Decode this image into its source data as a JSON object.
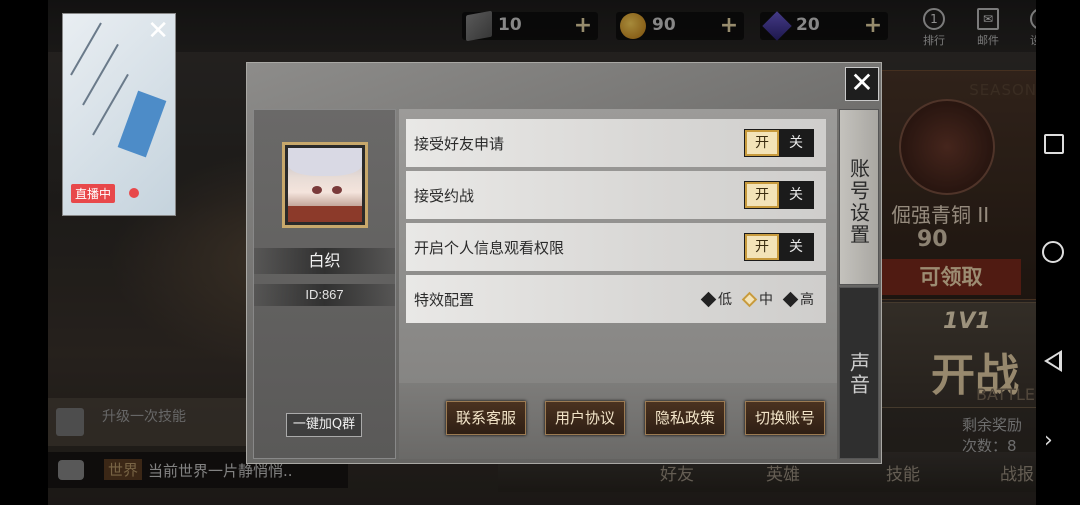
{
  "background": {
    "resources": [
      {
        "icon": "book-icon",
        "value": "10"
      },
      {
        "icon": "coin-icon",
        "value": "90"
      },
      {
        "icon": "gem-icon",
        "value": "20"
      }
    ],
    "top_icons": [
      {
        "icon": "rank-icon",
        "badge": "1",
        "label": "排行"
      },
      {
        "icon": "mail-icon",
        "badge": "",
        "label": "邮件"
      },
      {
        "icon": "gear-icon",
        "badge": "",
        "label": "设置"
      }
    ],
    "season": {
      "word": "SEASON",
      "rank": "倔强青铜 II",
      "score": "90",
      "claim": "可领取"
    },
    "battle": {
      "mode": "1V1",
      "title": "开战",
      "sub": "BATTLE"
    },
    "remaining_rewards": "剩余奖励次数：8",
    "skill_hint": "升级一次技能",
    "chat": {
      "tag": "世界",
      "message": "当前世界一片静悄悄.."
    },
    "bottom_nav": [
      "好友",
      "英雄",
      "技能",
      "战报"
    ],
    "live": {
      "badge": "直播中"
    }
  },
  "dialog": {
    "profile": {
      "name": "白织",
      "id": "ID:867",
      "qgroup_button": "一键加Q群"
    },
    "settings": [
      {
        "label": "接受好友申请",
        "on": "开",
        "off": "关"
      },
      {
        "label": "接受约战",
        "on": "开",
        "off": "关"
      },
      {
        "label": "开启个人信息观看权限",
        "on": "开",
        "off": "关"
      }
    ],
    "effects": {
      "label": "特效配置",
      "options": [
        "低",
        "中",
        "高"
      ],
      "selected": "中"
    },
    "actions": [
      "联系客服",
      "用户协议",
      "隐私政策",
      "切换账号"
    ],
    "tabs": [
      {
        "label": "账号设置",
        "active": true
      },
      {
        "label": "声音",
        "active": false
      }
    ]
  }
}
